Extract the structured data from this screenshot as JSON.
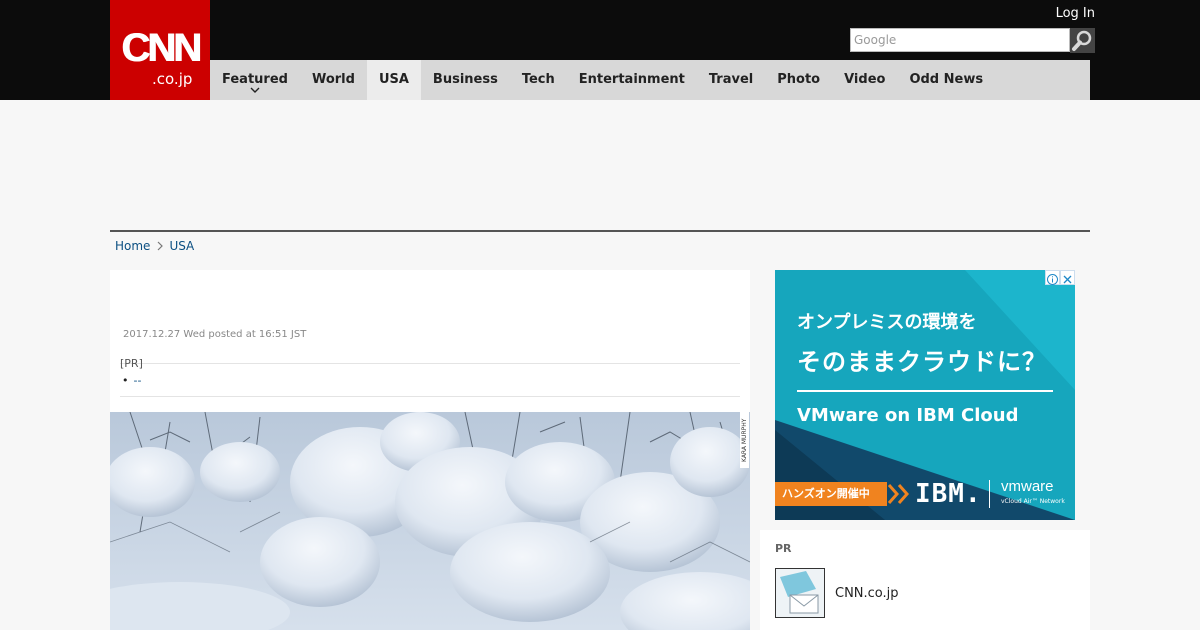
{
  "header": {
    "logo_main": "CNN",
    "logo_sub": ".co.jp",
    "login_label": "Log In",
    "search_placeholder": "Google",
    "search_icon": "magnifier-icon"
  },
  "nav": {
    "items": [
      {
        "label": "Featured",
        "has_dropdown": true
      },
      {
        "label": "World"
      },
      {
        "label": "USA",
        "active": true
      },
      {
        "label": "Business"
      },
      {
        "label": "Tech"
      },
      {
        "label": "Entertainment"
      },
      {
        "label": "Travel"
      },
      {
        "label": "Photo"
      },
      {
        "label": "Video"
      },
      {
        "label": "Odd News"
      }
    ]
  },
  "breadcrumb": {
    "home": "Home",
    "current": "USA"
  },
  "article": {
    "dateline": "2017.12.27 Wed posted at 16:51 JST",
    "pr_tag": "[PR]",
    "pr_link": "--",
    "photo_credit": "KARA MURPHY"
  },
  "ad": {
    "line1": "オンプレミスの環境を",
    "line2": "そのままクラウドに？",
    "line3": "VMware on IBM Cloud",
    "cta": "ハンズオン開催中",
    "ibm": "IBM.",
    "vmware": "vmware",
    "vmware_sub": "vCloud Air™ Network",
    "colors": {
      "bg": "#16a6bd",
      "accent": "#f0831f"
    }
  },
  "pr_box": {
    "heading": "PR",
    "item_name": "CNN.co.jp"
  },
  "colors": {
    "brand_red": "#cc0000",
    "header_black": "#0c0c0c",
    "nav_gray": "#d8d8d8",
    "link_blue": "#0b4f82"
  }
}
